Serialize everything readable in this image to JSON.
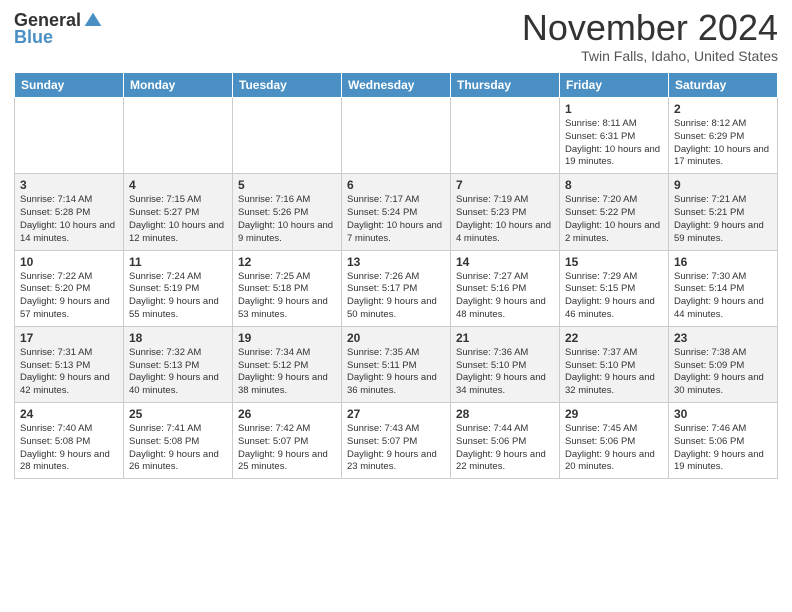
{
  "logo": {
    "general": "General",
    "blue": "Blue"
  },
  "title": "November 2024",
  "location": "Twin Falls, Idaho, United States",
  "days_header": [
    "Sunday",
    "Monday",
    "Tuesday",
    "Wednesday",
    "Thursday",
    "Friday",
    "Saturday"
  ],
  "weeks": [
    [
      {
        "day": "",
        "info": ""
      },
      {
        "day": "",
        "info": ""
      },
      {
        "day": "",
        "info": ""
      },
      {
        "day": "",
        "info": ""
      },
      {
        "day": "",
        "info": ""
      },
      {
        "day": "1",
        "info": "Sunrise: 8:11 AM\nSunset: 6:31 PM\nDaylight: 10 hours and 19 minutes."
      },
      {
        "day": "2",
        "info": "Sunrise: 8:12 AM\nSunset: 6:29 PM\nDaylight: 10 hours and 17 minutes."
      }
    ],
    [
      {
        "day": "3",
        "info": "Sunrise: 7:14 AM\nSunset: 5:28 PM\nDaylight: 10 hours and 14 minutes."
      },
      {
        "day": "4",
        "info": "Sunrise: 7:15 AM\nSunset: 5:27 PM\nDaylight: 10 hours and 12 minutes."
      },
      {
        "day": "5",
        "info": "Sunrise: 7:16 AM\nSunset: 5:26 PM\nDaylight: 10 hours and 9 minutes."
      },
      {
        "day": "6",
        "info": "Sunrise: 7:17 AM\nSunset: 5:24 PM\nDaylight: 10 hours and 7 minutes."
      },
      {
        "day": "7",
        "info": "Sunrise: 7:19 AM\nSunset: 5:23 PM\nDaylight: 10 hours and 4 minutes."
      },
      {
        "day": "8",
        "info": "Sunrise: 7:20 AM\nSunset: 5:22 PM\nDaylight: 10 hours and 2 minutes."
      },
      {
        "day": "9",
        "info": "Sunrise: 7:21 AM\nSunset: 5:21 PM\nDaylight: 9 hours and 59 minutes."
      }
    ],
    [
      {
        "day": "10",
        "info": "Sunrise: 7:22 AM\nSunset: 5:20 PM\nDaylight: 9 hours and 57 minutes."
      },
      {
        "day": "11",
        "info": "Sunrise: 7:24 AM\nSunset: 5:19 PM\nDaylight: 9 hours and 55 minutes."
      },
      {
        "day": "12",
        "info": "Sunrise: 7:25 AM\nSunset: 5:18 PM\nDaylight: 9 hours and 53 minutes."
      },
      {
        "day": "13",
        "info": "Sunrise: 7:26 AM\nSunset: 5:17 PM\nDaylight: 9 hours and 50 minutes."
      },
      {
        "day": "14",
        "info": "Sunrise: 7:27 AM\nSunset: 5:16 PM\nDaylight: 9 hours and 48 minutes."
      },
      {
        "day": "15",
        "info": "Sunrise: 7:29 AM\nSunset: 5:15 PM\nDaylight: 9 hours and 46 minutes."
      },
      {
        "day": "16",
        "info": "Sunrise: 7:30 AM\nSunset: 5:14 PM\nDaylight: 9 hours and 44 minutes."
      }
    ],
    [
      {
        "day": "17",
        "info": "Sunrise: 7:31 AM\nSunset: 5:13 PM\nDaylight: 9 hours and 42 minutes."
      },
      {
        "day": "18",
        "info": "Sunrise: 7:32 AM\nSunset: 5:13 PM\nDaylight: 9 hours and 40 minutes."
      },
      {
        "day": "19",
        "info": "Sunrise: 7:34 AM\nSunset: 5:12 PM\nDaylight: 9 hours and 38 minutes."
      },
      {
        "day": "20",
        "info": "Sunrise: 7:35 AM\nSunset: 5:11 PM\nDaylight: 9 hours and 36 minutes."
      },
      {
        "day": "21",
        "info": "Sunrise: 7:36 AM\nSunset: 5:10 PM\nDaylight: 9 hours and 34 minutes."
      },
      {
        "day": "22",
        "info": "Sunrise: 7:37 AM\nSunset: 5:10 PM\nDaylight: 9 hours and 32 minutes."
      },
      {
        "day": "23",
        "info": "Sunrise: 7:38 AM\nSunset: 5:09 PM\nDaylight: 9 hours and 30 minutes."
      }
    ],
    [
      {
        "day": "24",
        "info": "Sunrise: 7:40 AM\nSunset: 5:08 PM\nDaylight: 9 hours and 28 minutes."
      },
      {
        "day": "25",
        "info": "Sunrise: 7:41 AM\nSunset: 5:08 PM\nDaylight: 9 hours and 26 minutes."
      },
      {
        "day": "26",
        "info": "Sunrise: 7:42 AM\nSunset: 5:07 PM\nDaylight: 9 hours and 25 minutes."
      },
      {
        "day": "27",
        "info": "Sunrise: 7:43 AM\nSunset: 5:07 PM\nDaylight: 9 hours and 23 minutes."
      },
      {
        "day": "28",
        "info": "Sunrise: 7:44 AM\nSunset: 5:06 PM\nDaylight: 9 hours and 22 minutes."
      },
      {
        "day": "29",
        "info": "Sunrise: 7:45 AM\nSunset: 5:06 PM\nDaylight: 9 hours and 20 minutes."
      },
      {
        "day": "30",
        "info": "Sunrise: 7:46 AM\nSunset: 5:06 PM\nDaylight: 9 hours and 19 minutes."
      }
    ]
  ]
}
